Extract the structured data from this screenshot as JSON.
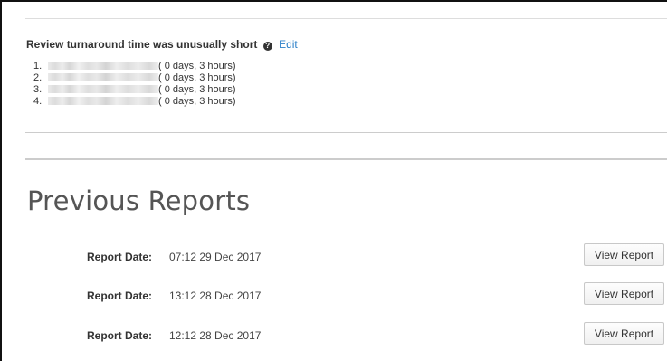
{
  "review": {
    "title": "Review turnaround time was unusually short",
    "help_icon": "question-circle-icon",
    "edit_label": "Edit",
    "items": [
      {
        "num": "1.",
        "detail": "( 0 days, 3 hours)"
      },
      {
        "num": "2.",
        "detail": "( 0 days, 3 hours)"
      },
      {
        "num": "3.",
        "detail": "( 0 days, 3 hours)"
      },
      {
        "num": "4.",
        "detail": "( 0 days, 3 hours)"
      }
    ]
  },
  "previous_reports": {
    "title": "Previous Reports",
    "rows": [
      {
        "label": "Report Date:",
        "date": "07:12 29 Dec 2017",
        "button": "View Report"
      },
      {
        "label": "Report Date:",
        "date": "13:12 28 Dec 2017",
        "button": "View Report"
      },
      {
        "label": "Report Date:",
        "date": "12:12 28 Dec 2017",
        "button": "View Report"
      }
    ]
  },
  "colors": {
    "link": "#2a7fc8",
    "text": "#333333",
    "rule": "#cccccc"
  }
}
